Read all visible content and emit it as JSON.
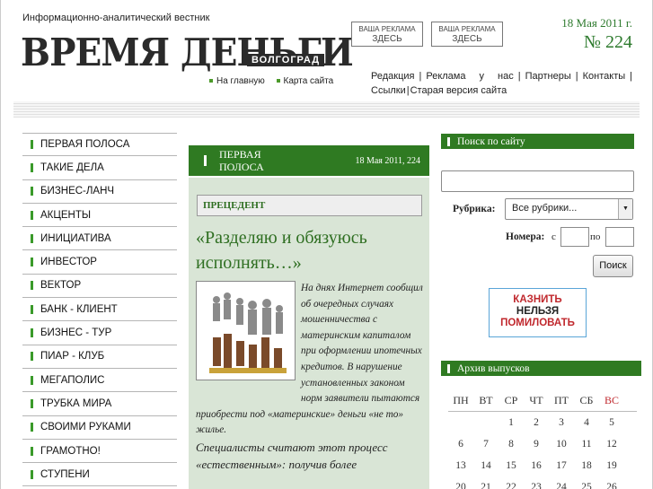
{
  "header": {
    "tagline": "Информационно-аналитический вестник",
    "logo_main": "ВРЕМЯ ДЕНЬГИ",
    "logo_city": "ВОЛГОГРАД",
    "toplinks": [
      "На главную",
      "Карта сайта"
    ],
    "ads": [
      {
        "line1": "ВАША РЕКЛАМА",
        "line2": "ЗДЕСЬ"
      },
      {
        "line1": "ВАША РЕКЛАМА",
        "line2": "ЗДЕСЬ"
      }
    ],
    "date": "18 Мая 2011 г.",
    "issue": "№ 224",
    "nav": [
      "Редакция",
      "Реклама у нас",
      "Партнеры",
      "Контакты",
      "Ссылки",
      "Старая версия сайта"
    ]
  },
  "sidebar": {
    "items": [
      "ПЕРВАЯ ПОЛОСА",
      "ТАКИЕ ДЕЛА",
      "БИЗНЕС-ЛАНЧ",
      "АКЦЕНТЫ",
      "ИНИЦИАТИВА",
      "ИНВЕСТОР",
      "ВЕКТОР",
      "БАНК - КЛИЕНТ",
      "БИЗНЕС - ТУР",
      "ПИАР - КЛУБ",
      "МЕГАПОЛИС",
      "ТРУБКА МИРА",
      "СВОИМИ РУКАМИ",
      "ГРАМОТНО!",
      "СТУПЕНИ"
    ]
  },
  "main": {
    "section": "ПЕРВАЯ ПОЛОСА",
    "section_date": "18 Мая 2011, 224",
    "rubric": "ПРЕЦЕДЕНТ",
    "headline": "«Разделяю и обязуюсь исполнять…»",
    "body": "На днях Интернет сообщил об очередных случаях мошенничества с материнским капиталом при оформлении ипотечных кредитов. В нарушение установленных законом норм заявители пытаются приобрести под «материнские» деньги «не то» жилье.",
    "more": "Специалисты считают этот процесс «естественным»: получив более"
  },
  "search": {
    "title": "Поиск по сайту",
    "rubric_label": "Рубрика:",
    "rubric_value": "Все рубрики...",
    "numbers_label": "Номера:",
    "from_label": "с",
    "to_label": "по",
    "button": "Поиск"
  },
  "banner": {
    "line1": "КАЗНИТЬ",
    "line2": "НЕЛЬЗЯ",
    "line3": "ПОМИЛОВАТЬ"
  },
  "archive": {
    "title": "Архив выпусков",
    "weekdays": [
      "ПН",
      "ВТ",
      "СР",
      "ЧТ",
      "ПТ",
      "СБ",
      "ВС"
    ],
    "weeks": [
      [
        "",
        "",
        "1",
        "2",
        "3",
        "4",
        "5"
      ],
      [
        "6",
        "7",
        "8",
        "9",
        "10",
        "11",
        "12"
      ],
      [
        "13",
        "14",
        "15",
        "16",
        "17",
        "18",
        "19"
      ],
      [
        "20",
        "21",
        "22",
        "23",
        "24",
        "25",
        "26"
      ]
    ]
  },
  "colors": {
    "accent": "#2f7a22",
    "light_green": "#d9e5d6",
    "red": "#c0282d"
  }
}
